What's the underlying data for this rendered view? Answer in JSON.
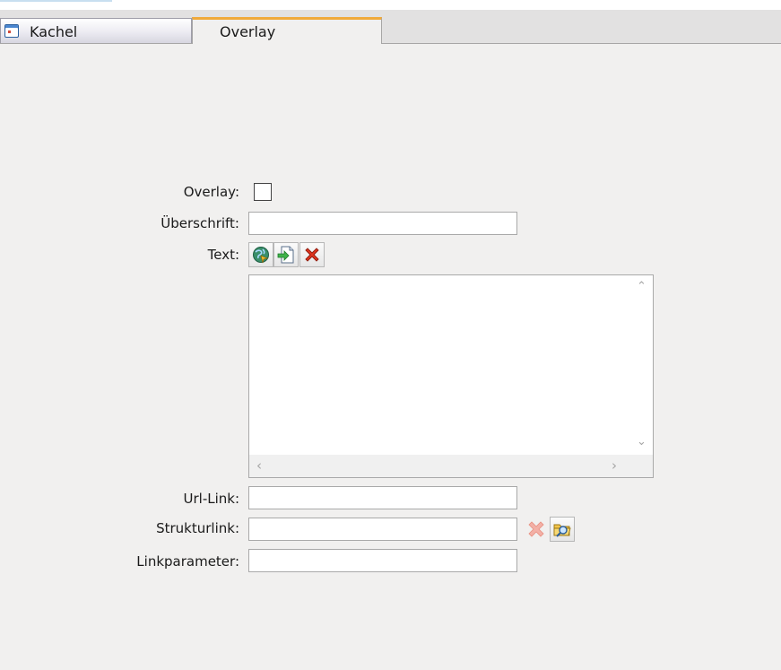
{
  "tabs": [
    {
      "label": "Kachel",
      "active": false
    },
    {
      "label": "Overlay",
      "active": true
    }
  ],
  "form": {
    "overlay_label": "Overlay:",
    "overlay_checked": false,
    "ueberschrift_label": "Überschrift:",
    "ueberschrift_value": "",
    "text_label": "Text:",
    "text_value": "",
    "urllink_label": "Url-Link:",
    "urllink_value": "",
    "strukturlink_label": "Strukturlink:",
    "strukturlink_value": "",
    "linkparameter_label": "Linkparameter:",
    "linkparameter_value": ""
  },
  "icons": {
    "text_toolbar": [
      "globe-link-icon",
      "insert-document-icon",
      "delete-x-icon"
    ],
    "strukturlink_actions": [
      "delete-x-disabled-icon",
      "browse-folder-icon"
    ],
    "tab_kachel": "window-icon"
  },
  "colors": {
    "active_tab_accent": "#f0a93a",
    "background": "#f1f0ef",
    "delete_red": "#e0341e"
  }
}
